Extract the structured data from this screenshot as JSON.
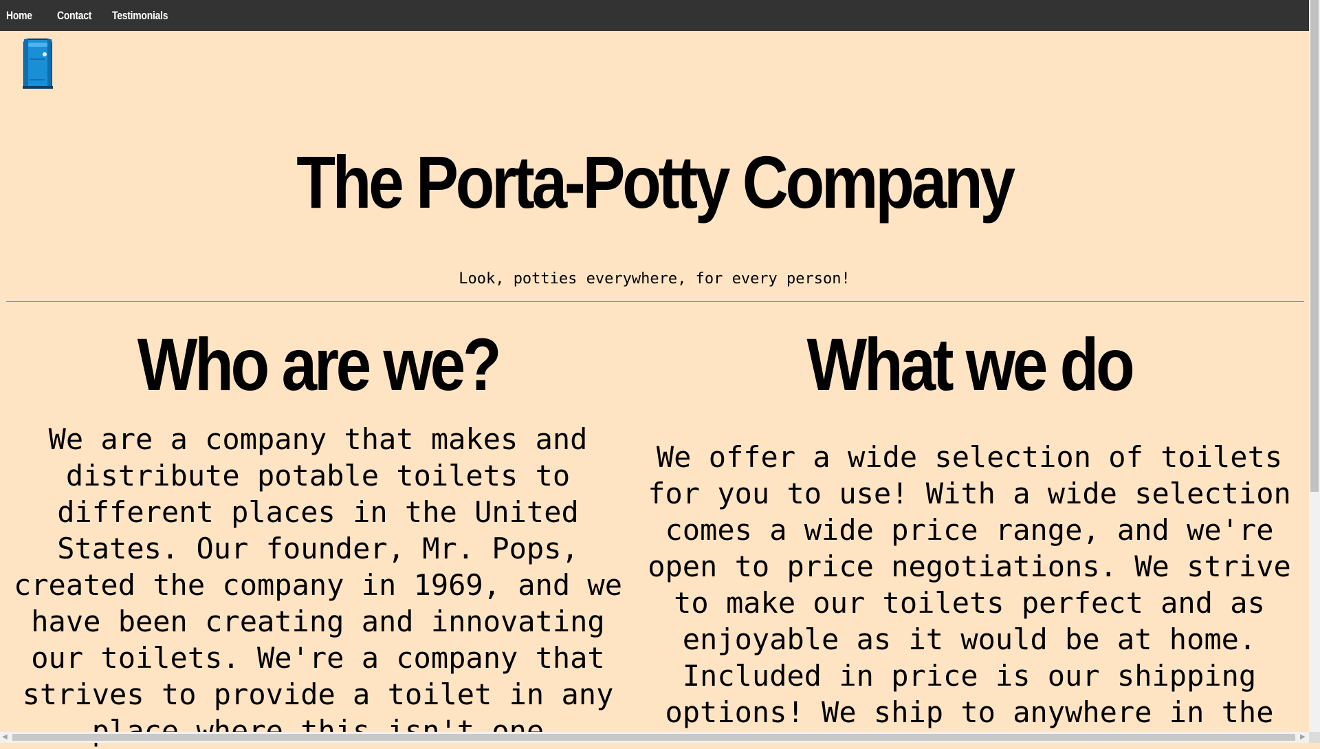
{
  "nav": {
    "items": [
      {
        "label": "Home"
      },
      {
        "label": "Contact"
      },
      {
        "label": "Testimonials"
      }
    ]
  },
  "logo": {
    "icon": "porta-potty-icon",
    "color": "#1a8fd6"
  },
  "header": {
    "title": "The Porta-Potty Company",
    "tagline": "Look, potties everywhere, for every person!"
  },
  "sections": [
    {
      "heading": "Who are we?",
      "text": "We are a company that makes and distribute potable toilets to different places in the United States. Our founder, Mr. Pops, created the company in 1969, and we have been creating and innovating our toilets. We're a company that strives to provide a toilet in any place where this isn't one"
    },
    {
      "heading": "What we do",
      "text": "We offer a wide selection of toilets for you to use! With a wide selection comes a wide price range, and we're open to price negotiations. We strive to make our toilets perfect and as enjoyable as it would be at home. Included in price is our shipping options! We ship to anywhere in the"
    }
  ],
  "colors": {
    "background": "#ffe4c4",
    "navbar": "#333333"
  }
}
